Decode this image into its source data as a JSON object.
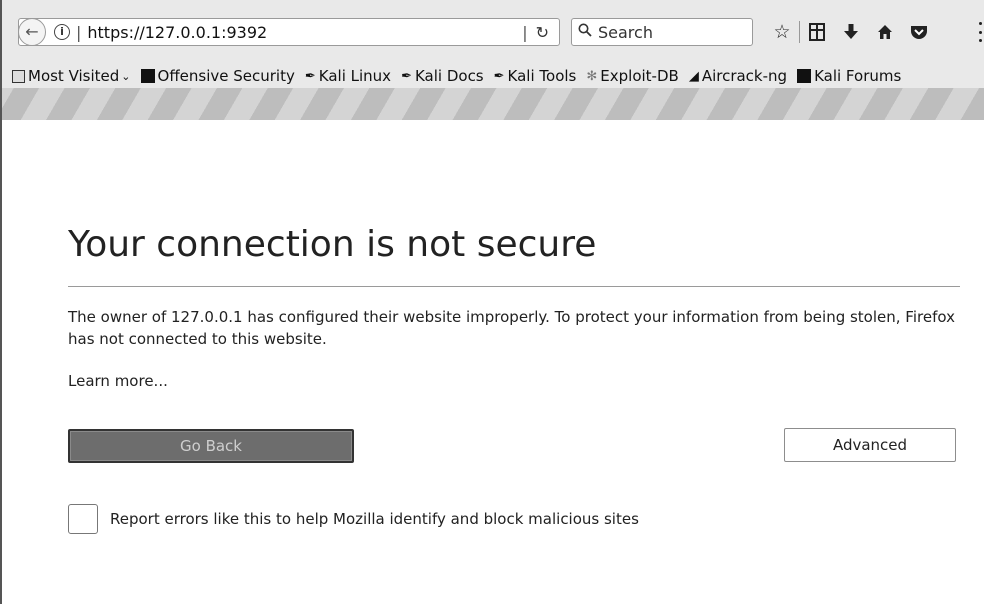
{
  "navbar": {
    "url_info_glyph": "i",
    "url_separator": "|",
    "url": "https://127.0.0.1:9392",
    "reload_separator": "|",
    "reload_glyph": "C",
    "search_glyph": "Q",
    "search_placeholder": "Search",
    "icons": [
      "back-arrow-icon",
      "info-icon",
      "reload-icon",
      "search-icon",
      "bookmark-star-icon",
      "reading-list-icon",
      "download-icon",
      "home-icon",
      "pocket-icon",
      "menu-icon"
    ]
  },
  "bookmarks": {
    "items": [
      {
        "label": "Most Visited",
        "icon": "bookmark-folder-icon"
      },
      {
        "label": "Offensive Security",
        "icon": "offensive-security-icon"
      },
      {
        "label": "Kali Linux",
        "icon": "kali-icon"
      },
      {
        "label": "Kali Docs",
        "icon": "kali-icon"
      },
      {
        "label": "Kali Tools",
        "icon": "kali-icon"
      },
      {
        "label": "Exploit-DB",
        "icon": "exploit-db-icon"
      },
      {
        "label": "Aircrack-ng",
        "icon": "aircrack-icon"
      },
      {
        "label": "Kali Forums",
        "icon": "kali-forums-icon"
      }
    ]
  },
  "page": {
    "title": "Your connection is not secure",
    "description": "The owner of 127.0.0.1 has configured their website improperly. To protect your information from being stolen, Firefox has not connected to this website.",
    "learn_more": "Learn more...",
    "go_back_label": "Go Back",
    "advanced_label": "Advanced",
    "report_label": "Report errors like this to help Mozilla identify and block malicious sites",
    "report_checked": false
  }
}
